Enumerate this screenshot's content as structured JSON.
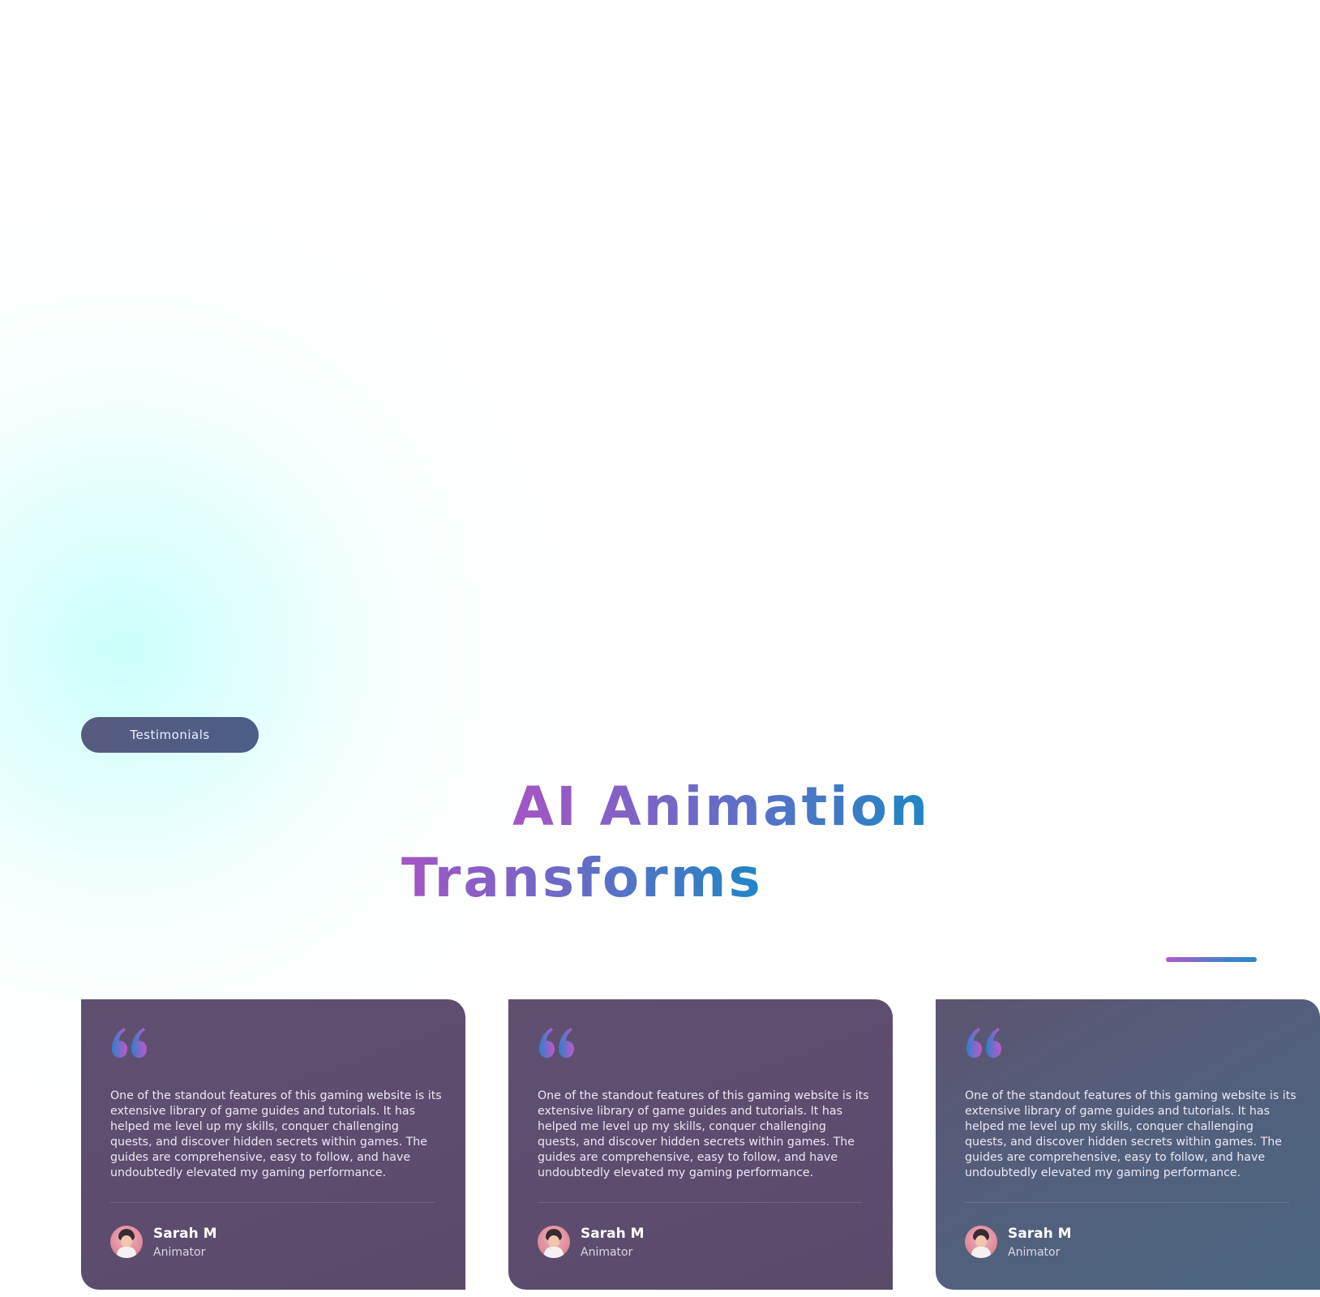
{
  "section": {
    "badge_label": "Testimonials",
    "heading_line1": "AI Animation",
    "heading_line2": "Transforms"
  },
  "colors": {
    "gradient_purple": "#a455c4",
    "gradient_blue": "#1f86c6",
    "card_bg": "#5d4c6e",
    "badge_bg": "#525c84",
    "glow_cyan": "#c8fffa"
  },
  "testimonials": [
    {
      "quote": "One of the standout features of this gaming website is its extensive library of game guides and tutorials. It has helped me level up my skills, conquer challenging quests, and discover hidden secrets within games. The guides are comprehensive, easy to follow, and have undoubtedly elevated my gaming performance.",
      "name": "Sarah M",
      "role": "Animator",
      "icon": "quote-icon"
    },
    {
      "quote": "One of the standout features of this gaming website is its extensive library of game guides and tutorials. It has helped me level up my skills, conquer challenging quests, and discover hidden secrets within games. The guides are comprehensive, easy to follow, and have undoubtedly elevated my gaming performance.",
      "name": "Sarah M",
      "role": "Animator",
      "icon": "quote-icon"
    },
    {
      "quote": "One of the standout features of this gaming website is its extensive library of game guides and tutorials. It has helped me level up my skills, conquer challenging quests, and discover hidden secrets within games. The guides are comprehensive, easy to follow, and have undoubtedly elevated my gaming performance.",
      "name": "Sarah M",
      "role": "Animator",
      "icon": "quote-icon"
    }
  ]
}
